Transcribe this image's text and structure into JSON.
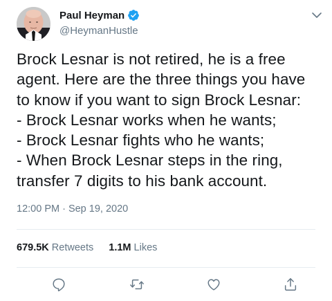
{
  "author": {
    "display_name": "Paul Heyman",
    "handle": "@HeymanHustle",
    "verified": true,
    "avatar_icon": "avatar-photo"
  },
  "tweet": {
    "lines": [
      "Brock Lesnar is not retired, he is a free",
      "agent. Here are the three things you have",
      "to know if you want to sign Brock Lesnar:",
      "- Brock Lesnar works when he wants;",
      "- Brock Lesnar fights who he wants;",
      "- When Brock Lesnar steps in the ring,",
      "transfer 7 digits to his bank account."
    ],
    "timestamp": "12:00 PM · Sep 19, 2020"
  },
  "stats": {
    "retweets_count": "679.5K",
    "retweets_label": "Retweets",
    "likes_count": "1.1M",
    "likes_label": "Likes"
  },
  "actions": [
    "reply-icon",
    "retweet-icon",
    "like-icon",
    "share-icon"
  ],
  "colors": {
    "text": "#14171a",
    "secondary": "#657786",
    "accent": "#1da1f2",
    "divider": "#e6ecf0"
  }
}
